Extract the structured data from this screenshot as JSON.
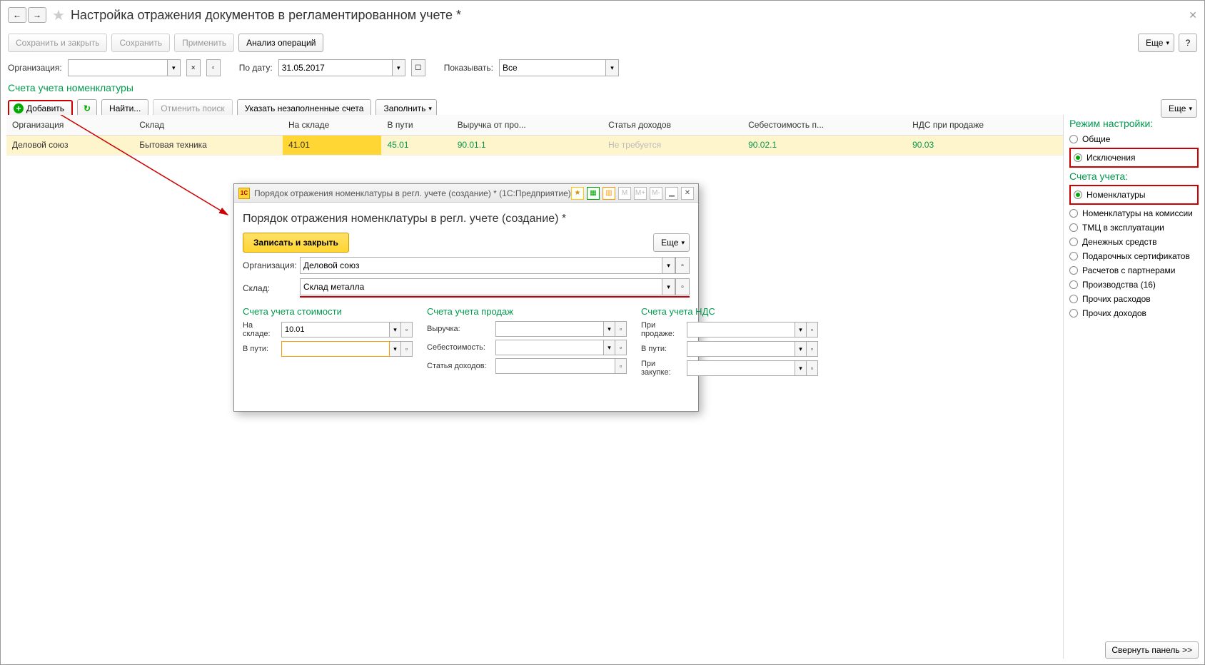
{
  "title": "Настройка отражения документов в регламентированном учете *",
  "nav": {
    "back": "←",
    "fwd": "→"
  },
  "toolbar": {
    "save_close": "Сохранить и закрыть",
    "save": "Сохранить",
    "apply": "Применить",
    "analysis": "Анализ операций",
    "more": "Еще",
    "help": "?"
  },
  "filters": {
    "org_label": "Организация:",
    "org_value": "",
    "date_label": "По дату:",
    "date_value": "31.05.2017",
    "show_label": "Показывать:",
    "show_value": "Все"
  },
  "section_title": "Счета учета номенклатуры",
  "tbl_toolbar": {
    "add": "Добавить",
    "refresh": "↻",
    "find": "Найти...",
    "cancel_find": "Отменить поиск",
    "fill_empty": "Указать незаполненные счета",
    "fill": "Заполнить",
    "more": "Еще"
  },
  "table": {
    "cols": [
      "Организация",
      "Склад",
      "На складе",
      "В пути",
      "Выручка от про...",
      "Статья доходов",
      "Себестоимость п...",
      "НДС при продаже"
    ],
    "row": {
      "org": "Деловой союз",
      "sklad": "Бытовая техника",
      "onstock": "41.01",
      "inway": "45.01",
      "rev": "90.01.1",
      "statya": "Не требуется",
      "cost": "90.02.1",
      "nds": "90.03"
    }
  },
  "right": {
    "mode_head": "Режим настройки:",
    "modes": {
      "common": "Общие",
      "excl": "Исключения"
    },
    "accounts_head": "Счета учета:",
    "opts": {
      "nomen": "Номенклатуры",
      "nomen_kom": "Номенклатуры на комиссии",
      "tmc": "ТМЦ в эксплуатации",
      "cash": "Денежных средств",
      "gift": "Подарочных сертификатов",
      "part": "Расчетов с партнерами",
      "prod": "Производства (16)",
      "exp": "Прочих расходов",
      "inc": "Прочих доходов"
    },
    "collapse": "Свернуть панель >>"
  },
  "dialog": {
    "win_title": "Порядок отражения номенклатуры в регл. учете (создание) *  (1С:Предприятие)",
    "heading": "Порядок отражения номенклатуры в регл. учете (создание) *",
    "write_close": "Записать и закрыть",
    "more": "Еще",
    "org_label": "Организация:",
    "org_value": "Деловой союз",
    "sklad_label": "Склад:",
    "sklad_value": "Склад металла",
    "sec1": {
      "head": "Счета учета стоимости",
      "onstock_l": "На складе:",
      "onstock_v": "10.01",
      "inway_l": "В пути:",
      "inway_v": ""
    },
    "sec2": {
      "head": "Счета учета продаж",
      "rev_l": "Выручка:",
      "cost_l": "Себестоимость:",
      "statya_l": "Статья доходов:"
    },
    "sec3": {
      "head": "Счета учета НДС",
      "sale_l": "При продаже:",
      "inway_l": "В пути:",
      "buy_l": "При закупке:"
    },
    "tools": {
      "m": "M",
      "mplus": "M+",
      "mminus": "M-"
    }
  }
}
